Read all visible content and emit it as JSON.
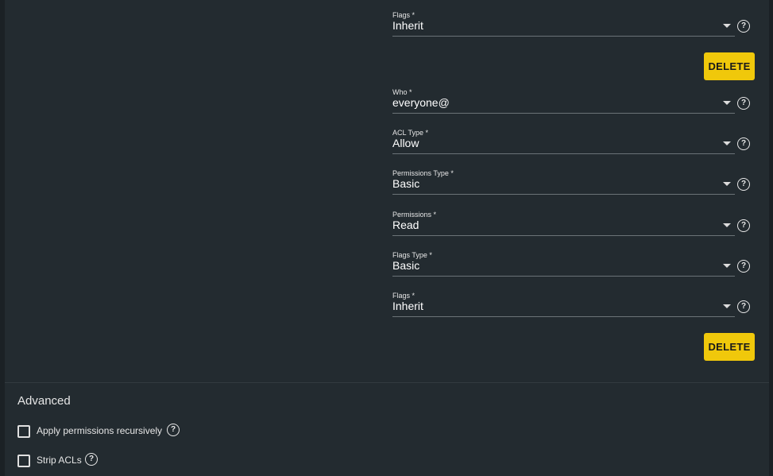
{
  "ace_entry_1": {
    "flags": {
      "label": "Flags *",
      "value": "Inherit"
    },
    "delete_label": "DELETE"
  },
  "ace_entry_2": {
    "who": {
      "label": "Who *",
      "value": "everyone@"
    },
    "acl_type": {
      "label": "ACL Type *",
      "value": "Allow"
    },
    "permissions_type": {
      "label": "Permissions Type *",
      "value": "Basic"
    },
    "permissions": {
      "label": "Permissions *",
      "value": "Read"
    },
    "flags_type": {
      "label": "Flags Type *",
      "value": "Basic"
    },
    "flags": {
      "label": "Flags *",
      "value": "Inherit"
    },
    "delete_label": "DELETE"
  },
  "advanced": {
    "title": "Advanced",
    "apply_recursively": {
      "label": "Apply permissions recursively",
      "checked": false
    },
    "strip_acls": {
      "label": "Strip ACLs",
      "checked": false
    }
  },
  "help_glyph": "?",
  "colors": {
    "background": "#232b30",
    "accent_button": "#f0c80b",
    "text": "#ffffff",
    "underline": "#6b7377"
  },
  "icons": [
    "chevron-down-icon",
    "help-icon",
    "checkbox-icon"
  ]
}
